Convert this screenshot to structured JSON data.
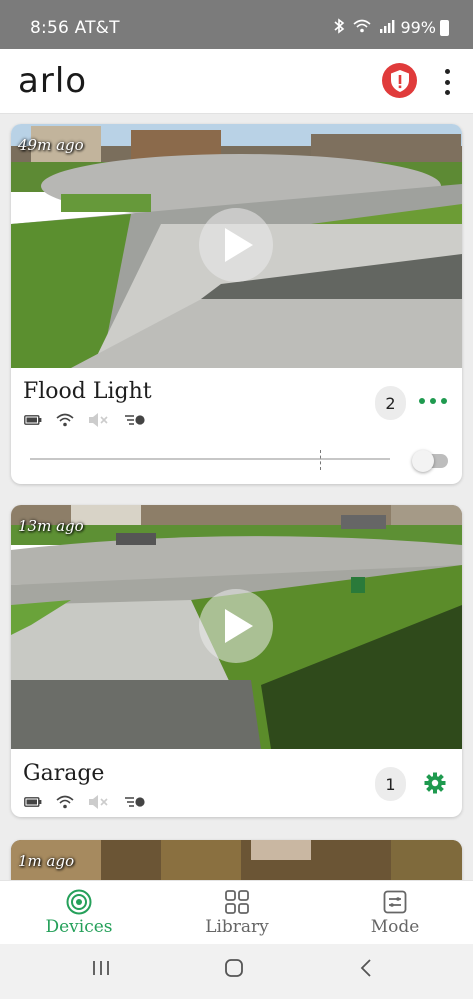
{
  "status_bar": {
    "time": "8:56 AT&T",
    "battery_pct": "99%",
    "icons": [
      "bluetooth-icon",
      "wifi-icon",
      "signal-icon",
      "battery-icon"
    ]
  },
  "header": {
    "logo": "arlo",
    "alert_icon": "shield-alert-icon",
    "menu_icon": "more-vertical-icon",
    "colors": {
      "alert": "#e03b3b"
    }
  },
  "devices": [
    {
      "thumb_age": "49m ago",
      "name": "Flood Light",
      "count": "2",
      "action_icon": "more-horizontal-icon",
      "status_icons": [
        "battery-icon",
        "wifi-icon",
        "speaker-muted-icon",
        "motion-icon"
      ],
      "light_toggle_on": false
    },
    {
      "thumb_age": "13m ago",
      "name": "Garage",
      "count": "1",
      "action_icon": "gear-icon",
      "status_icons": [
        "battery-icon",
        "wifi-icon",
        "speaker-muted-icon",
        "motion-icon"
      ]
    },
    {
      "thumb_age": "1m ago"
    }
  ],
  "bottom_nav": {
    "items": [
      {
        "label": "Devices",
        "icon": "devices-icon",
        "active": true
      },
      {
        "label": "Library",
        "icon": "library-icon",
        "active": false
      },
      {
        "label": "Mode",
        "icon": "mode-icon",
        "active": false
      }
    ],
    "active_color": "#25a05a"
  },
  "system_nav": [
    "recents-icon",
    "home-icon",
    "back-icon"
  ]
}
